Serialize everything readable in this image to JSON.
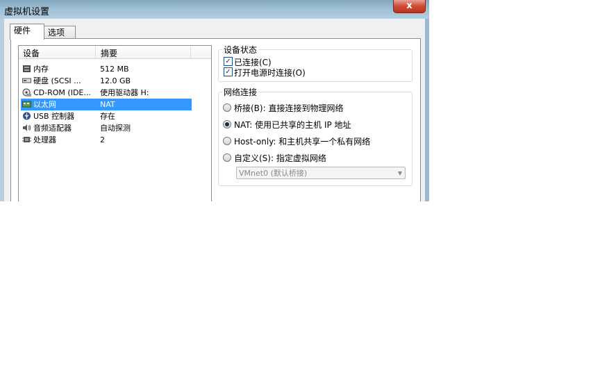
{
  "window": {
    "title": "虚拟机设置",
    "close_label": "x"
  },
  "tabs": [
    {
      "label": "硬件"
    },
    {
      "label": "选项"
    }
  ],
  "device_list": {
    "headers": {
      "device": "设备",
      "summary": "摘要"
    },
    "rows": [
      {
        "name": "内存",
        "summary": "512 MB",
        "icon": "memory-icon"
      },
      {
        "name": "硬盘 (SCSI ...",
        "summary": "12.0 GB",
        "icon": "harddisk-icon"
      },
      {
        "name": "CD-ROM (IDE...",
        "summary": "使用驱动器 H:",
        "icon": "cdrom-icon"
      },
      {
        "name": "以太网",
        "summary": "NAT",
        "icon": "network-adapter-icon",
        "selected": true
      },
      {
        "name": "USB 控制器",
        "summary": "存在",
        "icon": "usb-icon"
      },
      {
        "name": "音频适配器",
        "summary": "自动探测",
        "icon": "speaker-icon"
      },
      {
        "name": "处理器",
        "summary": "2",
        "icon": "processor-icon"
      }
    ]
  },
  "device_status": {
    "legend": "设备状态",
    "connected": {
      "label": "已连接(C)",
      "checked": true
    },
    "connect_at_power_on": {
      "label": "打开电源时连接(O)",
      "checked": true
    }
  },
  "network_connection": {
    "legend": "网络连接",
    "options": [
      {
        "label": "桥接(B): 直接连接到物理网络",
        "selected": false
      },
      {
        "label": "NAT: 使用已共享的主机 IP 地址",
        "selected": true
      },
      {
        "label": "Host-only: 和主机共享一个私有网络",
        "selected": false
      },
      {
        "label": "自定义(S): 指定虚拟网络",
        "selected": false
      }
    ],
    "custom_network": {
      "value": "VMnet0 (默认桥接)"
    }
  },
  "colors": {
    "selection": "#3399ff",
    "titlebar": "#9fbfd3",
    "close": "#cf4a34"
  }
}
